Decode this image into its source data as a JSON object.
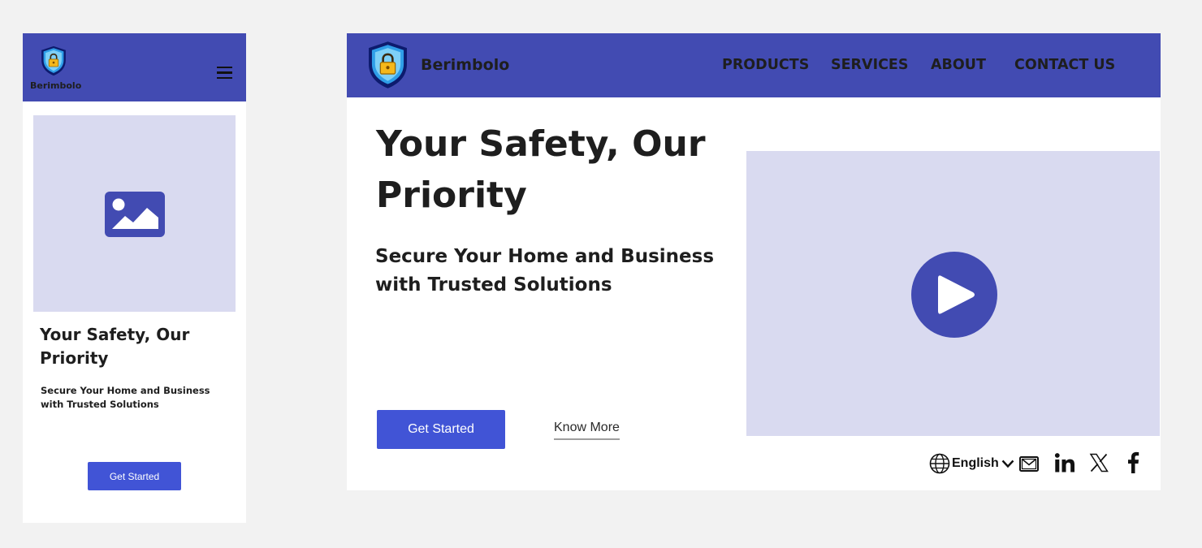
{
  "colors": {
    "brand": "#424bb2",
    "accent": "#4154d6",
    "placeholder": "#d9daf0",
    "text": "#1e1e1e",
    "background": "#f2f2f2"
  },
  "mobile": {
    "header": {
      "brand_name": "Berimbolo",
      "logo_icon": "shield-lock-icon",
      "menu_icon": "hamburger-icon"
    },
    "hero": {
      "image_icon": "image-placeholder-icon",
      "title": "Your Safety, Our Priority",
      "subtitle": "Secure Your Home and Business with Trusted Solutions",
      "cta_label": "Get Started"
    }
  },
  "desktop": {
    "header": {
      "brand_name": "Berimbolo",
      "logo_icon": "shield-lock-icon",
      "nav": [
        {
          "label": "PRODUCTS"
        },
        {
          "label": "SERVICES"
        },
        {
          "label": "ABOUT"
        },
        {
          "label": "CONTACT US"
        }
      ]
    },
    "hero": {
      "title": "Your Safety, Our Priority",
      "subtitle": "Secure Your Home and Business with Trusted Solutions",
      "cta_label": "Get Started",
      "secondary_label": "Know More",
      "video_icon": "play-icon"
    },
    "footer": {
      "language": "English",
      "language_icon": "globe-icon",
      "dropdown_icon": "chevron-down-icon",
      "social_icons": [
        "mail-icon",
        "linkedin-icon",
        "x-icon",
        "facebook-icon"
      ]
    }
  }
}
